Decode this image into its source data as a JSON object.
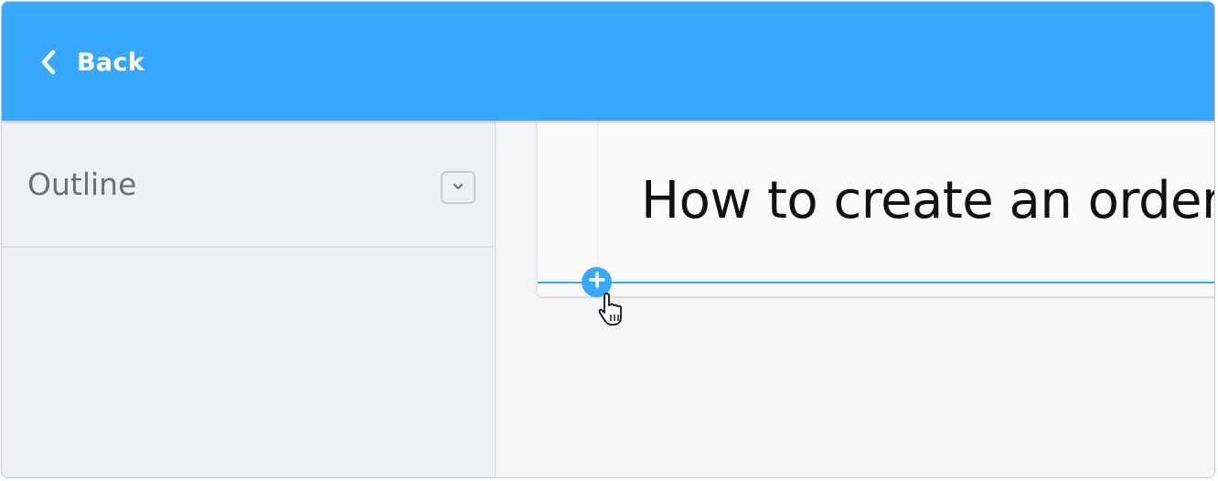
{
  "header": {
    "back_label": "Back",
    "back_icon": "chevron-left-icon",
    "background_color": "#38a8ff"
  },
  "sidebar": {
    "title": "Outline",
    "toggle_icon": "chevron-down-icon"
  },
  "editor": {
    "title": "How to create an order",
    "add_block_icon": "plus-icon",
    "accent_color": "#38a8ff"
  },
  "pointer": {
    "icon": "hand-pointer-icon"
  }
}
